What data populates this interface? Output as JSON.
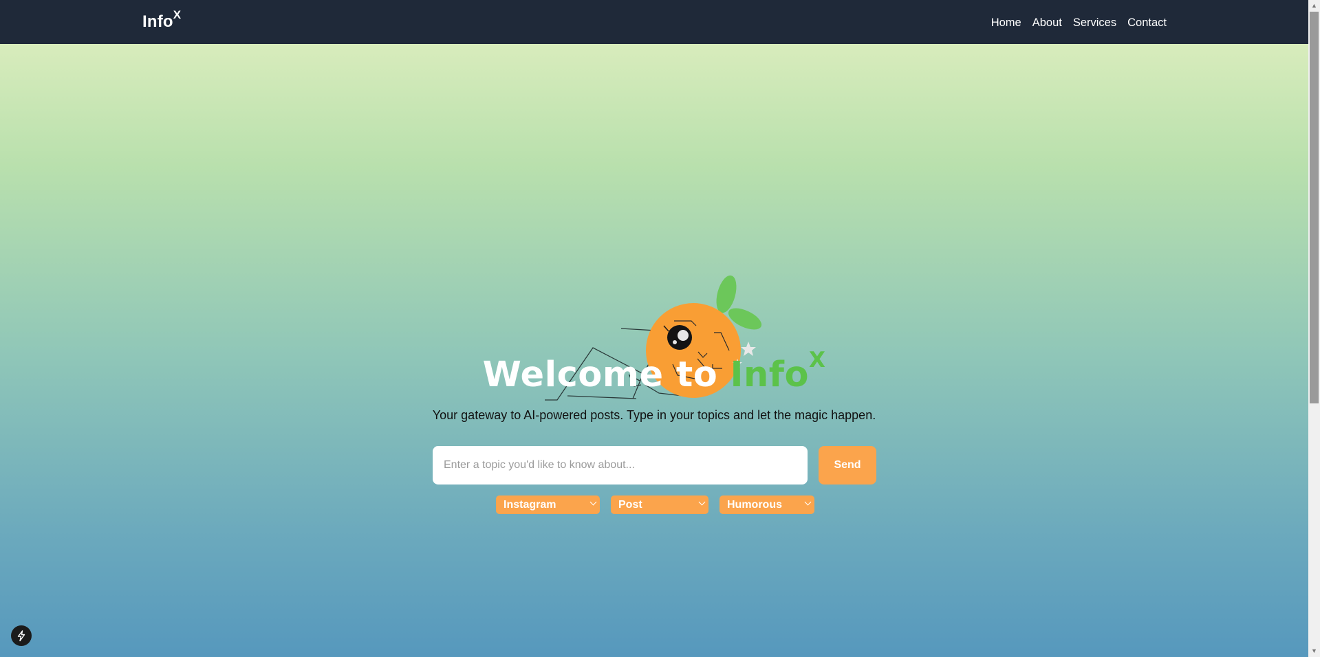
{
  "navbar": {
    "brand": "Info",
    "brand_sup": "X",
    "links": [
      "Home",
      "About",
      "Services",
      "Contact"
    ]
  },
  "hero": {
    "title_prefix": "Welcome to ",
    "title_accent": "Info",
    "title_sup": "X",
    "subtitle": "Your gateway to AI-powered posts. Type in your topics and let the magic happen."
  },
  "search": {
    "placeholder": "Enter a topic you'd like to know about...",
    "value": "",
    "send_label": "Send"
  },
  "selects": {
    "platform": "Instagram",
    "format": "Post",
    "tone": "Humorous"
  },
  "colors": {
    "navbar_bg": "#1f2939",
    "accent_orange": "#fba44c",
    "accent_green": "#5cc24a"
  },
  "icons": {
    "bottom_left": "lightning-bolt-icon",
    "mascot": "orange-mascot-illustration"
  }
}
